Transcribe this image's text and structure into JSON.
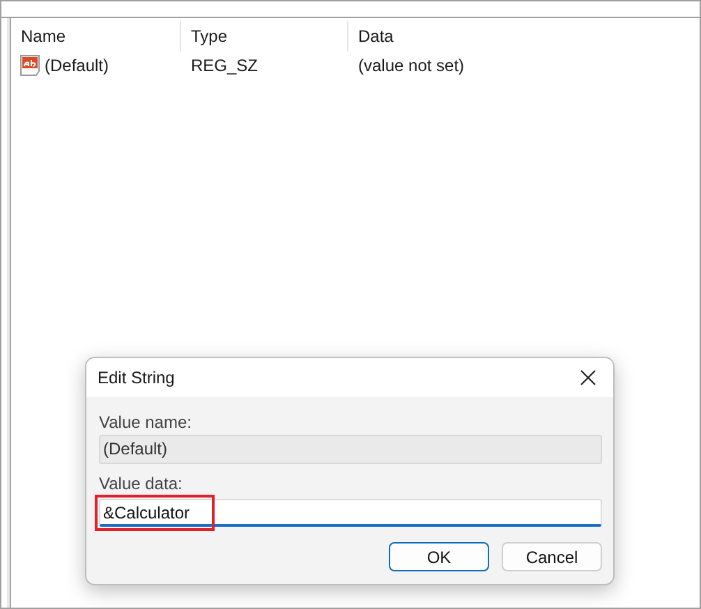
{
  "table": {
    "columns": [
      "Name",
      "Type",
      "Data"
    ],
    "rows": [
      {
        "name": "(Default)",
        "type": "REG_SZ",
        "data": "(value not set)"
      }
    ]
  },
  "dialog": {
    "title": "Edit String",
    "name_label": "Value name:",
    "name_value": "(Default)",
    "data_label": "Value data:",
    "data_value": "&Calculator",
    "data_highlighted": true,
    "buttons": [
      {
        "label": "OK",
        "kind": "default"
      },
      {
        "label": "Cancel",
        "kind": "normal"
      }
    ]
  }
}
